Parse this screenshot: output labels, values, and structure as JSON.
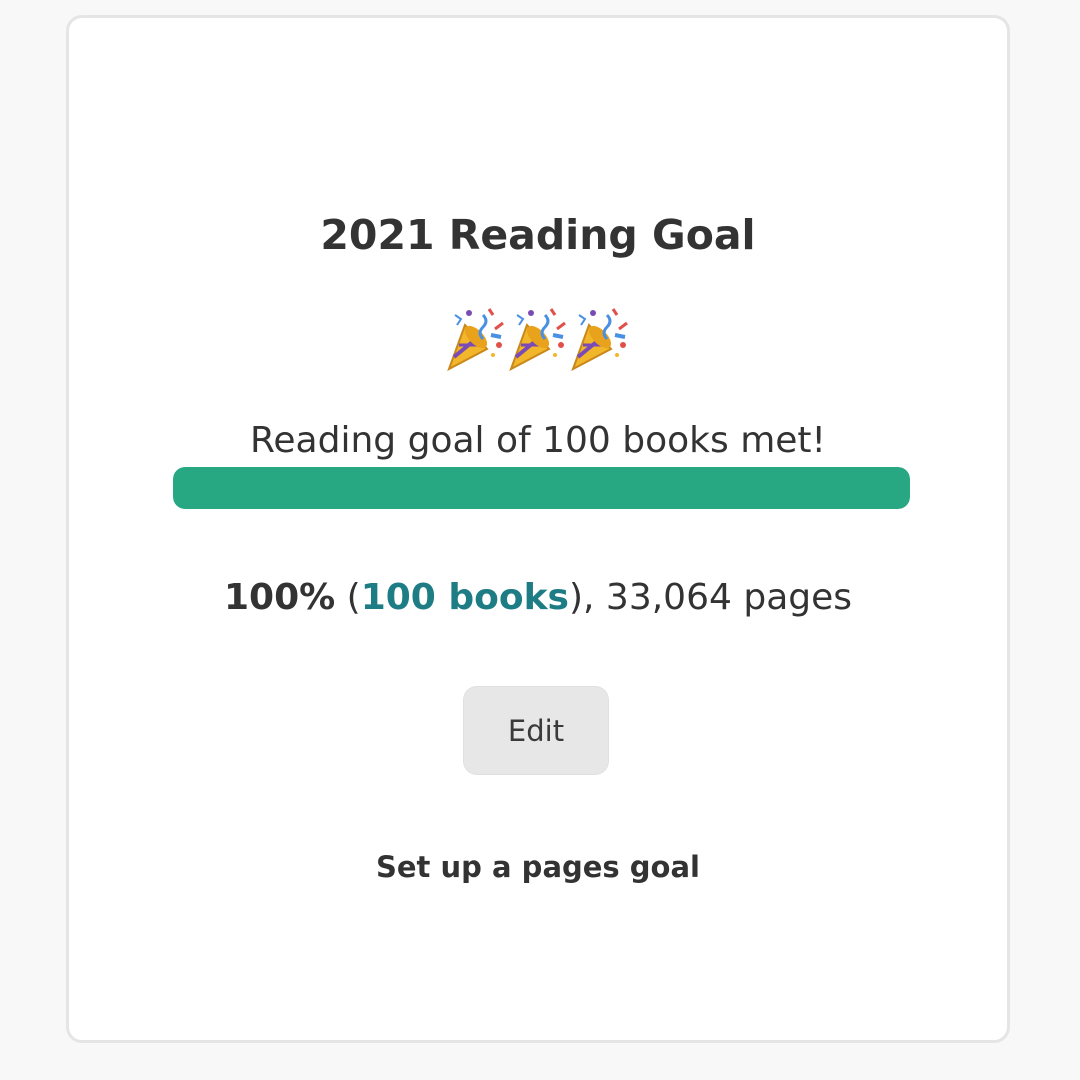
{
  "card": {
    "title": "2021 Reading Goal",
    "celebration_icons": [
      "party-popper-icon",
      "party-popper-icon",
      "party-popper-icon"
    ],
    "goal_message": "Reading goal of 100 books met!",
    "progress": {
      "percent": 100,
      "fill_color": "#27a882"
    },
    "stats": {
      "percent_text": "100%",
      "open_paren": " (",
      "books_link": "100 books",
      "close_text": "), 33,064 pages"
    },
    "edit_label": "Edit",
    "pages_goal_link": "Set up a pages goal"
  }
}
